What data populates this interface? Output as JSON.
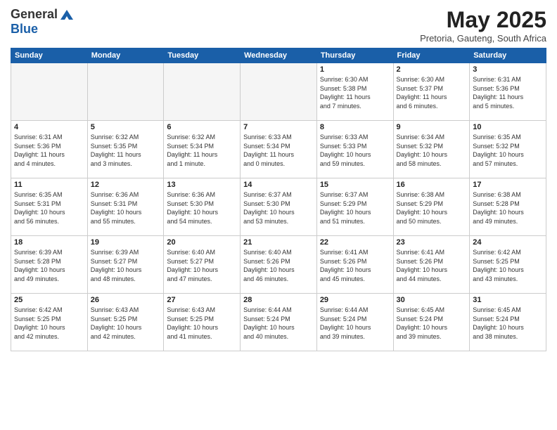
{
  "header": {
    "logo_general": "General",
    "logo_blue": "Blue",
    "month_year": "May 2025",
    "location": "Pretoria, Gauteng, South Africa"
  },
  "weekdays": [
    "Sunday",
    "Monday",
    "Tuesday",
    "Wednesday",
    "Thursday",
    "Friday",
    "Saturday"
  ],
  "weeks": [
    [
      {
        "day": "",
        "info": ""
      },
      {
        "day": "",
        "info": ""
      },
      {
        "day": "",
        "info": ""
      },
      {
        "day": "",
        "info": ""
      },
      {
        "day": "1",
        "info": "Sunrise: 6:30 AM\nSunset: 5:38 PM\nDaylight: 11 hours\nand 7 minutes."
      },
      {
        "day": "2",
        "info": "Sunrise: 6:30 AM\nSunset: 5:37 PM\nDaylight: 11 hours\nand 6 minutes."
      },
      {
        "day": "3",
        "info": "Sunrise: 6:31 AM\nSunset: 5:36 PM\nDaylight: 11 hours\nand 5 minutes."
      }
    ],
    [
      {
        "day": "4",
        "info": "Sunrise: 6:31 AM\nSunset: 5:36 PM\nDaylight: 11 hours\nand 4 minutes."
      },
      {
        "day": "5",
        "info": "Sunrise: 6:32 AM\nSunset: 5:35 PM\nDaylight: 11 hours\nand 3 minutes."
      },
      {
        "day": "6",
        "info": "Sunrise: 6:32 AM\nSunset: 5:34 PM\nDaylight: 11 hours\nand 1 minute."
      },
      {
        "day": "7",
        "info": "Sunrise: 6:33 AM\nSunset: 5:34 PM\nDaylight: 11 hours\nand 0 minutes."
      },
      {
        "day": "8",
        "info": "Sunrise: 6:33 AM\nSunset: 5:33 PM\nDaylight: 10 hours\nand 59 minutes."
      },
      {
        "day": "9",
        "info": "Sunrise: 6:34 AM\nSunset: 5:32 PM\nDaylight: 10 hours\nand 58 minutes."
      },
      {
        "day": "10",
        "info": "Sunrise: 6:35 AM\nSunset: 5:32 PM\nDaylight: 10 hours\nand 57 minutes."
      }
    ],
    [
      {
        "day": "11",
        "info": "Sunrise: 6:35 AM\nSunset: 5:31 PM\nDaylight: 10 hours\nand 56 minutes."
      },
      {
        "day": "12",
        "info": "Sunrise: 6:36 AM\nSunset: 5:31 PM\nDaylight: 10 hours\nand 55 minutes."
      },
      {
        "day": "13",
        "info": "Sunrise: 6:36 AM\nSunset: 5:30 PM\nDaylight: 10 hours\nand 54 minutes."
      },
      {
        "day": "14",
        "info": "Sunrise: 6:37 AM\nSunset: 5:30 PM\nDaylight: 10 hours\nand 53 minutes."
      },
      {
        "day": "15",
        "info": "Sunrise: 6:37 AM\nSunset: 5:29 PM\nDaylight: 10 hours\nand 51 minutes."
      },
      {
        "day": "16",
        "info": "Sunrise: 6:38 AM\nSunset: 5:29 PM\nDaylight: 10 hours\nand 50 minutes."
      },
      {
        "day": "17",
        "info": "Sunrise: 6:38 AM\nSunset: 5:28 PM\nDaylight: 10 hours\nand 49 minutes."
      }
    ],
    [
      {
        "day": "18",
        "info": "Sunrise: 6:39 AM\nSunset: 5:28 PM\nDaylight: 10 hours\nand 49 minutes."
      },
      {
        "day": "19",
        "info": "Sunrise: 6:39 AM\nSunset: 5:27 PM\nDaylight: 10 hours\nand 48 minutes."
      },
      {
        "day": "20",
        "info": "Sunrise: 6:40 AM\nSunset: 5:27 PM\nDaylight: 10 hours\nand 47 minutes."
      },
      {
        "day": "21",
        "info": "Sunrise: 6:40 AM\nSunset: 5:26 PM\nDaylight: 10 hours\nand 46 minutes."
      },
      {
        "day": "22",
        "info": "Sunrise: 6:41 AM\nSunset: 5:26 PM\nDaylight: 10 hours\nand 45 minutes."
      },
      {
        "day": "23",
        "info": "Sunrise: 6:41 AM\nSunset: 5:26 PM\nDaylight: 10 hours\nand 44 minutes."
      },
      {
        "day": "24",
        "info": "Sunrise: 6:42 AM\nSunset: 5:25 PM\nDaylight: 10 hours\nand 43 minutes."
      }
    ],
    [
      {
        "day": "25",
        "info": "Sunrise: 6:42 AM\nSunset: 5:25 PM\nDaylight: 10 hours\nand 42 minutes."
      },
      {
        "day": "26",
        "info": "Sunrise: 6:43 AM\nSunset: 5:25 PM\nDaylight: 10 hours\nand 42 minutes."
      },
      {
        "day": "27",
        "info": "Sunrise: 6:43 AM\nSunset: 5:25 PM\nDaylight: 10 hours\nand 41 minutes."
      },
      {
        "day": "28",
        "info": "Sunrise: 6:44 AM\nSunset: 5:24 PM\nDaylight: 10 hours\nand 40 minutes."
      },
      {
        "day": "29",
        "info": "Sunrise: 6:44 AM\nSunset: 5:24 PM\nDaylight: 10 hours\nand 39 minutes."
      },
      {
        "day": "30",
        "info": "Sunrise: 6:45 AM\nSunset: 5:24 PM\nDaylight: 10 hours\nand 39 minutes."
      },
      {
        "day": "31",
        "info": "Sunrise: 6:45 AM\nSunset: 5:24 PM\nDaylight: 10 hours\nand 38 minutes."
      }
    ]
  ]
}
